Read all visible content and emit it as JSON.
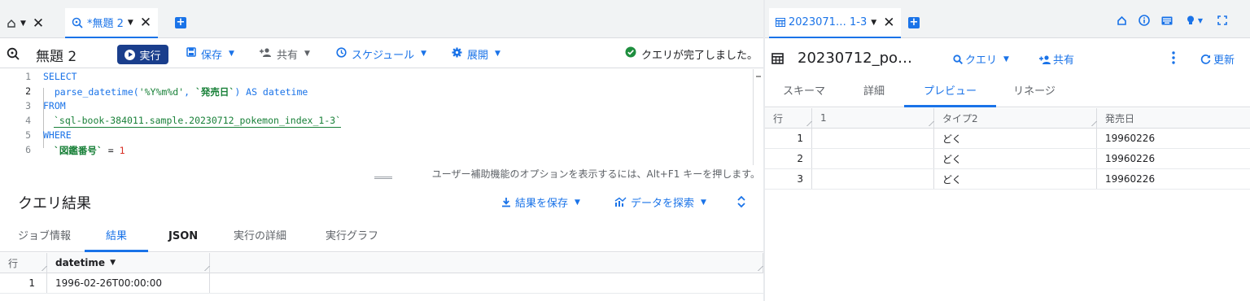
{
  "left_tabs": {
    "tab_label": "*無題 2"
  },
  "toolbar": {
    "query_title": "無題 2",
    "run_label": "実行",
    "save_label": "保存",
    "share_label": "共有",
    "schedule_label": "スケジュール",
    "deploy_label": "展開",
    "status_text": "クエリが完了しました。"
  },
  "editor": {
    "lines": [
      {
        "num": "1",
        "kw": "SELECT"
      },
      {
        "num": "2",
        "pre": "  parse_datetime(",
        "s1": "'%Y%m%d'",
        "mid": ", ",
        "s2": "`発売日`",
        "post": ") AS datetime"
      },
      {
        "num": "3",
        "kw": "FROM"
      },
      {
        "num": "4",
        "tbl": "`sql-book-384011.sample.20230712_pokemon_index_1-3`"
      },
      {
        "num": "5",
        "kw": "WHERE"
      },
      {
        "num": "6",
        "col": "`図鑑番号`",
        "op": " = ",
        "val": "1"
      }
    ],
    "a11y_hint": "ユーザー補助機能のオプションを表示するには、Alt+F1 キーを押します。"
  },
  "results": {
    "title": "クエリ結果",
    "save_results_label": "結果を保存",
    "explore_label": "データを探索",
    "tabs": [
      "ジョブ情報",
      "結果",
      "JSON",
      "実行の詳細",
      "実行グラフ"
    ],
    "header_row_label": "行",
    "column": "datetime",
    "rows": [
      {
        "n": "1",
        "datetime": "1996-02-26T00:00:00"
      }
    ]
  },
  "right_pane": {
    "tab_label": "2023071… 1-3",
    "title": "20230712_po…",
    "query_label": "クエリ",
    "share_label": "共有",
    "refresh_label": "更新",
    "tabs": [
      "スキーマ",
      "詳細",
      "プレビュー",
      "リネージ"
    ],
    "table": {
      "row_header": "行",
      "columns": [
        "1",
        "タイプ2",
        "発売日"
      ],
      "rows": [
        {
          "n": "1",
          "c1": "",
          "type2": "どく",
          "date": "19960226"
        },
        {
          "n": "2",
          "c1": "",
          "type2": "どく",
          "date": "19960226"
        },
        {
          "n": "3",
          "c1": "",
          "type2": "どく",
          "date": "19960226"
        }
      ]
    }
  },
  "colors": {
    "accent": "#1a73e8",
    "run_button": "#1a3e8c",
    "success": "#1e8e3e"
  }
}
